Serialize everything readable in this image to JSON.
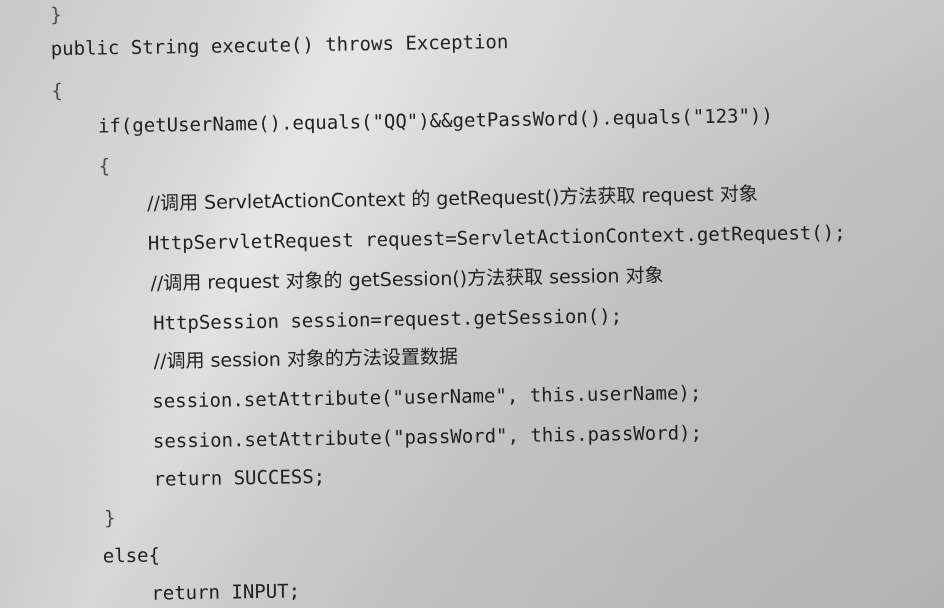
{
  "code_lines": [
    "}",
    "public String execute() throws Exception",
    "{",
    "if(getUserName().equals(\"QQ\")&&getPassWord().equals(\"123\"))",
    "{",
    "//调用 ServletActionContext 的 getRequest()方法获取 request 对象",
    "HttpServletRequest request=ServletActionContext.getRequest();",
    "//调用 request 对象的 getSession()方法获取 session 对象",
    "HttpSession session=request.getSession();",
    "//调用 session 对象的方法设置数据",
    "session.setAttribute(\"userName\", this.userName);",
    "session.setAttribute(\"passWord\", this.passWord);",
    "return SUCCESS;",
    "}",
    "else{",
    "return INPUT;"
  ]
}
